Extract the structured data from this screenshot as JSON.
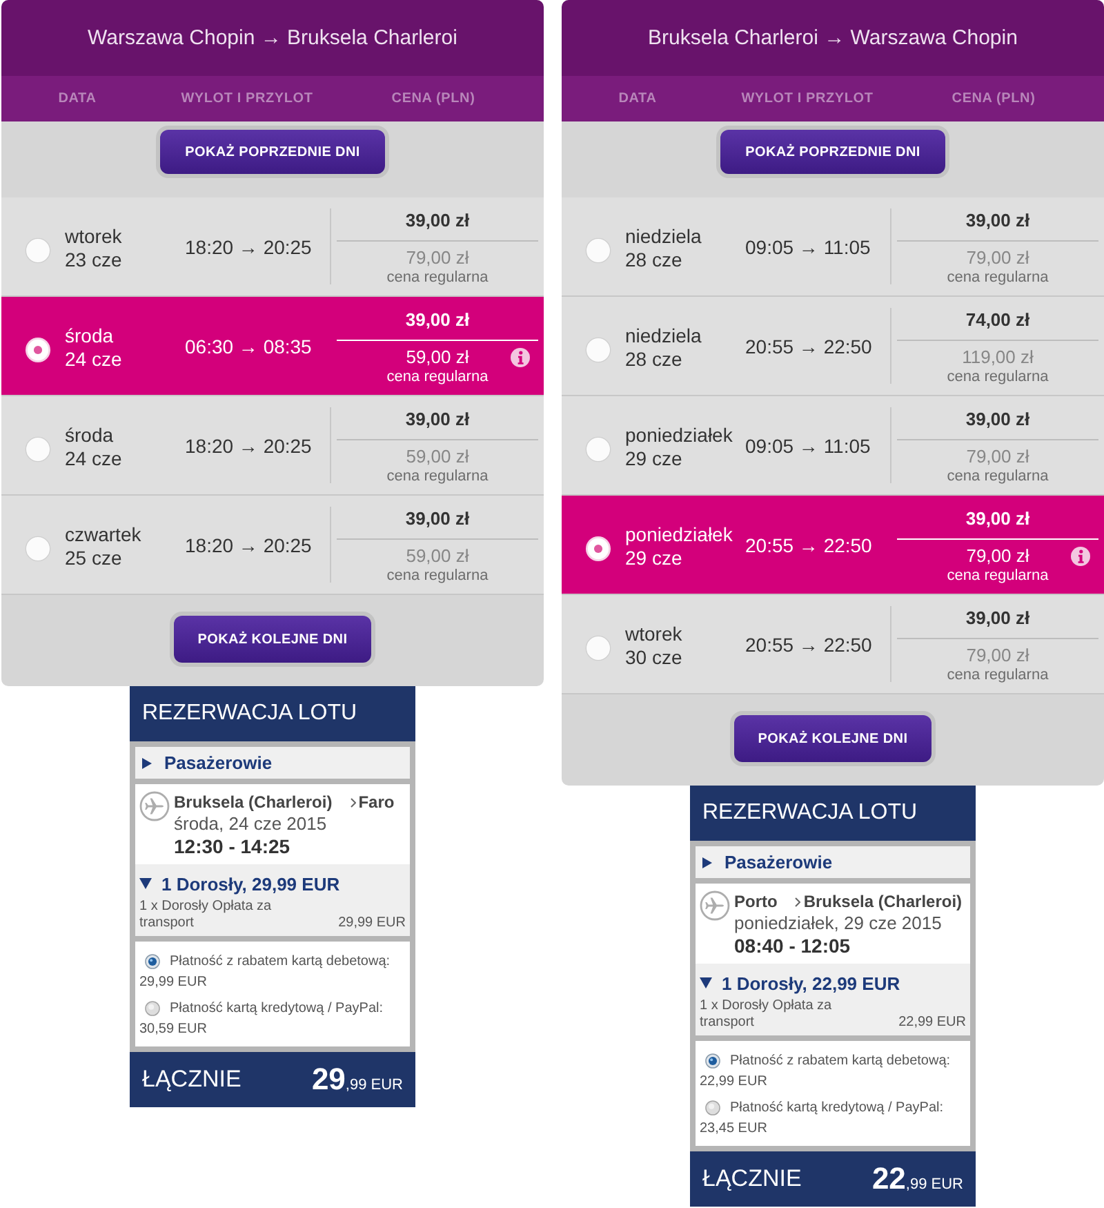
{
  "flights": [
    {
      "title": "Warszawa Chopin → Bruksela Charleroi",
      "columns": [
        "DATA",
        "WYLOT I PRZYLOT",
        "CENA (PLN)"
      ],
      "previous_button": "POKAŻ POPRZEDNIE DNI",
      "rows": [
        {
          "day": "wtorek",
          "date": "23 cze",
          "times": "18:20 → 20:25",
          "price": "39,00 zł",
          "regular_price": "79,00 zł",
          "regular_label": "cena regularna",
          "selected": false
        },
        {
          "day": "środa",
          "date": "24 cze",
          "times": "06:30 → 08:35",
          "price": "39,00 zł",
          "regular_price": "59,00 zł",
          "regular_label": "cena regularna",
          "selected": true
        },
        {
          "day": "środa",
          "date": "24 cze",
          "times": "18:20 → 20:25",
          "price": "39,00 zł",
          "regular_price": "59,00 zł",
          "regular_label": "cena regularna",
          "selected": false
        },
        {
          "day": "czwartek",
          "date": "25 cze",
          "times": "18:20 → 20:25",
          "price": "39,00 zł",
          "regular_price": "59,00 zł",
          "regular_label": "cena regularna",
          "selected": false
        }
      ],
      "next_button": "POKAŻ KOLEJNE DNI",
      "booking": {
        "title": "REZERWACJA LOTU",
        "passengers": {
          "label": "Pasażerowie",
          "expanded": false
        },
        "from": "Bruksela (Charleroi)",
        "to": "Faro",
        "date": "środa, 24 cze 2015",
        "times": "12:30 - 14:25",
        "fare": {
          "label": "1 Dorosły, 29,99 EUR",
          "expanded": true,
          "detail": "1 x Dorosły Opłata za transport",
          "amount": "29,99 EUR"
        },
        "payments": [
          {
            "label": "Płatność z rabatem kartą debetową:",
            "amount": "29,99 EUR",
            "selected": true
          },
          {
            "label": "Płatność kartą kredytową / PayPal:",
            "amount": "30,59 EUR",
            "selected": false
          }
        ],
        "total": {
          "label": "ŁĄCZNIE",
          "whole": "29",
          "fraction": ",99 EUR"
        }
      }
    },
    {
      "title": "Bruksela Charleroi → Warszawa Chopin",
      "columns": [
        "DATA",
        "WYLOT I PRZYLOT",
        "CENA (PLN)"
      ],
      "previous_button": "POKAŻ POPRZEDNIE DNI",
      "rows": [
        {
          "day": "niedziela",
          "date": "28 cze",
          "times": "09:05 → 11:05",
          "price": "39,00 zł",
          "regular_price": "79,00 zł",
          "regular_label": "cena regularna",
          "selected": false
        },
        {
          "day": "niedziela",
          "date": "28 cze",
          "times": "20:55 → 22:50",
          "price": "74,00 zł",
          "regular_price": "119,00 zł",
          "regular_label": "cena regularna",
          "selected": false
        },
        {
          "day": "poniedziałek",
          "date": "29 cze",
          "times": "09:05 → 11:05",
          "price": "39,00 zł",
          "regular_price": "79,00 zł",
          "regular_label": "cena regularna",
          "selected": false
        },
        {
          "day": "poniedziałek",
          "date": "29 cze",
          "times": "20:55 → 22:50",
          "price": "39,00 zł",
          "regular_price": "79,00 zł",
          "regular_label": "cena regularna",
          "selected": true
        },
        {
          "day": "wtorek",
          "date": "30 cze",
          "times": "20:55 → 22:50",
          "price": "39,00 zł",
          "regular_price": "79,00 zł",
          "regular_label": "cena regularna",
          "selected": false
        }
      ],
      "next_button": "POKAŻ KOLEJNE DNI",
      "booking": {
        "title": "REZERWACJA LOTU",
        "passengers": {
          "label": "Pasażerowie",
          "expanded": false
        },
        "from": "Porto",
        "to": "Bruksela (Charleroi)",
        "date": "poniedziałek, 29 cze 2015",
        "times": "08:40 - 12:05",
        "fare": {
          "label": "1 Dorosły, 22,99 EUR",
          "expanded": true,
          "detail": "1 x Dorosły Opłata za transport",
          "amount": "22,99 EUR"
        },
        "payments": [
          {
            "label": "Płatność z rabatem kartą debetową:",
            "amount": "22,99 EUR",
            "selected": true
          },
          {
            "label": "Płatność kartą kredytową / PayPal:",
            "amount": "23,45 EUR",
            "selected": false
          }
        ],
        "total": {
          "label": "ŁĄCZNIE",
          "whole": "22",
          "fraction": ",99 EUR"
        }
      }
    }
  ]
}
